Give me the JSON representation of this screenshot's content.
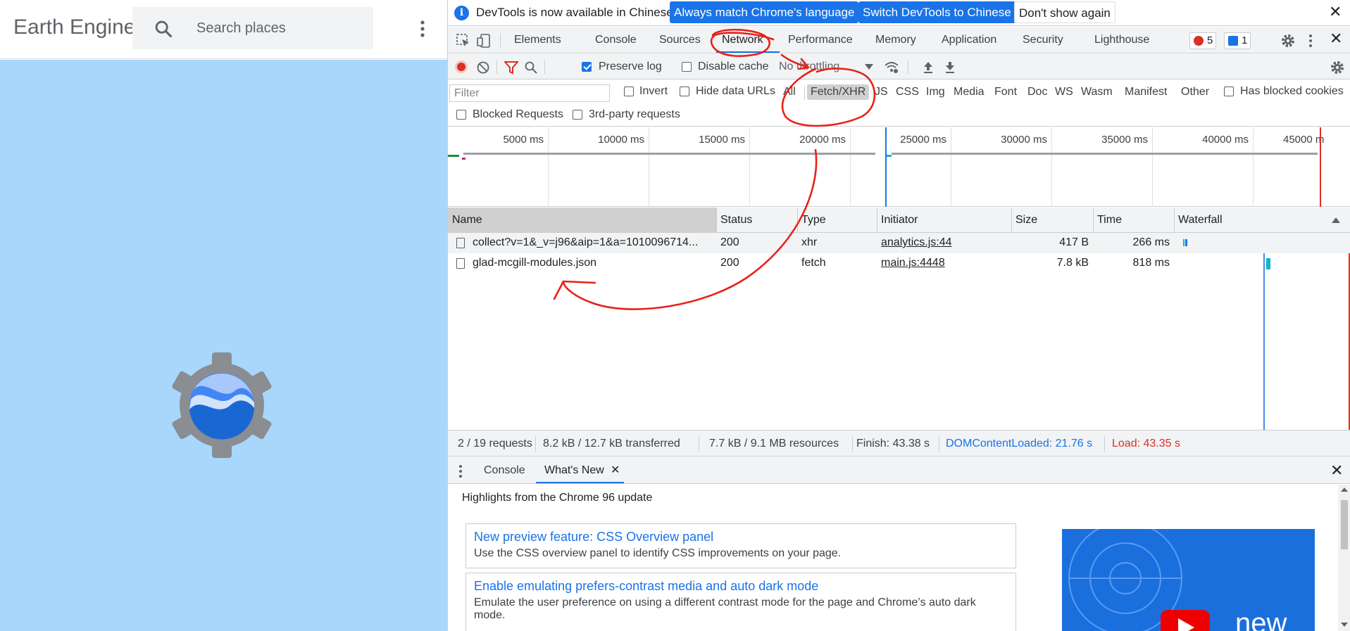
{
  "app": {
    "title": "Earth Engine A",
    "search_placeholder": "Search places",
    "background_color": "#a8d7fb"
  },
  "devtools": {
    "infobar": {
      "message": "DevTools is now available in Chinese!",
      "btn_match": "Always match Chrome's language",
      "btn_switch": "Switch DevTools to Chinese",
      "btn_dismiss": "Don't show again"
    },
    "tabs": [
      "Elements",
      "Console",
      "Sources",
      "Network",
      "Performance",
      "Memory",
      "Application",
      "Security",
      "Lighthouse"
    ],
    "active_tab": "Network",
    "error_count": "5",
    "message_count": "1",
    "toolbar": {
      "preserve_log": "Preserve log",
      "disable_cache": "Disable cache",
      "throttling": "No throttling"
    },
    "filter": {
      "placeholder": "Filter",
      "invert": "Invert",
      "hide_data_urls": "Hide data URLs",
      "types": [
        "All",
        "Fetch/XHR",
        "JS",
        "CSS",
        "Img",
        "Media",
        "Font",
        "Doc",
        "WS",
        "Wasm",
        "Manifest",
        "Other"
      ],
      "active_type": "Fetch/XHR",
      "has_blocked_cookies": "Has blocked cookies",
      "blocked_requests": "Blocked Requests",
      "third_party": "3rd-party requests"
    },
    "timeline_ticks": [
      "5000 ms",
      "10000 ms",
      "15000 ms",
      "20000 ms",
      "25000 ms",
      "30000 ms",
      "35000 ms",
      "40000 ms",
      "45000 m"
    ],
    "columns": {
      "name": "Name",
      "status": "Status",
      "type": "Type",
      "initiator": "Initiator",
      "size": "Size",
      "time": "Time",
      "waterfall": "Waterfall"
    },
    "requests": [
      {
        "name": "collect?v=1&_v=j96&aip=1&a=1010096714...",
        "status": "200",
        "type": "xhr",
        "initiator": "analytics.js:44",
        "size": "417 B",
        "time": "266 ms"
      },
      {
        "name": "glad-mcgill-modules.json",
        "status": "200",
        "type": "fetch",
        "initiator": "main.js:4448",
        "size": "7.8 kB",
        "time": "818 ms"
      }
    ],
    "summary": {
      "requests": "2 / 19 requests",
      "transferred": "8.2 kB / 12.7 kB transferred",
      "resources": "7.7 kB / 9.1 MB resources",
      "finish": "Finish: 43.38 s",
      "dcl": "DOMContentLoaded: 21.76 s",
      "load": "Load: 43.35 s"
    },
    "drawer": {
      "tab_console": "Console",
      "tab_whats_new": "What's New",
      "highlights": "Highlights from the Chrome 96 update",
      "cards": [
        {
          "title": "New preview feature: CSS Overview panel",
          "desc": "Use the CSS overview panel to identify CSS improvements on your page."
        },
        {
          "title": "Enable emulating prefers-contrast media and auto dark mode",
          "desc": "Emulate the user preference on using a different contrast mode for the page and Chrome’s auto dark mode."
        }
      ],
      "promo_text": "new"
    }
  },
  "colors": {
    "accent": "#1a73e8",
    "annotation": "#e8201a",
    "error": "#d93025",
    "dcl": "#1a73e8",
    "load": "#d93025"
  }
}
